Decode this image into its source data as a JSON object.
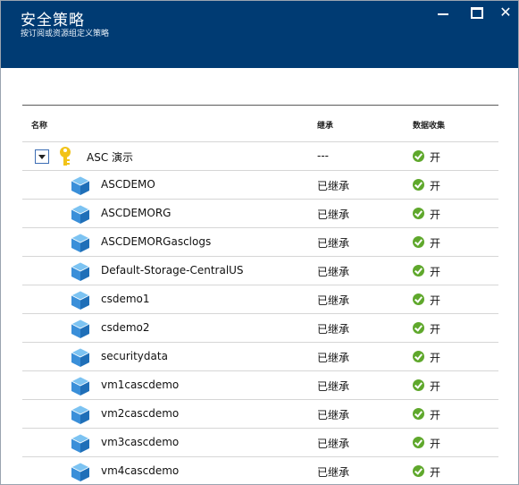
{
  "window": {
    "title": "安全策略",
    "subtitle": "按订阅或资源组定义策略",
    "close_glyph": "✕"
  },
  "table": {
    "headers": {
      "name": "名称",
      "inherit": "继承",
      "collect": "数据收集"
    },
    "root": {
      "name": "ASC 演示",
      "inherit": "---",
      "collect": "开",
      "icon": "key-icon"
    },
    "rows": [
      {
        "name": "ASCDEMO",
        "inherit": "已继承",
        "collect": "开"
      },
      {
        "name": "ASCDEMORG",
        "inherit": "已继承",
        "collect": "开"
      },
      {
        "name": "ASCDEMORGasclogs",
        "inherit": "已继承",
        "collect": "开"
      },
      {
        "name": "Default-Storage-CentralUS",
        "inherit": "已继承",
        "collect": "开"
      },
      {
        "name": "csdemo1",
        "inherit": "已继承",
        "collect": "开"
      },
      {
        "name": "csdemo2",
        "inherit": "已继承",
        "collect": "开"
      },
      {
        "name": "securitydata",
        "inherit": "已继承",
        "collect": "开"
      },
      {
        "name": "vm1cascdemo",
        "inherit": "已继承",
        "collect": "开"
      },
      {
        "name": "vm2cascdemo",
        "inherit": "已继承",
        "collect": "开"
      },
      {
        "name": "vm3cascdemo",
        "inherit": "已继承",
        "collect": "开"
      },
      {
        "name": "vm4cascdemo",
        "inherit": "已继承",
        "collect": "开"
      }
    ],
    "row_icon": "resource-group-cube-icon",
    "status_icon": "green-check-icon"
  },
  "colors": {
    "header": "#003b73",
    "check": "#5fa82c",
    "cube": "#3a8fd9",
    "key": "#f2c319"
  }
}
